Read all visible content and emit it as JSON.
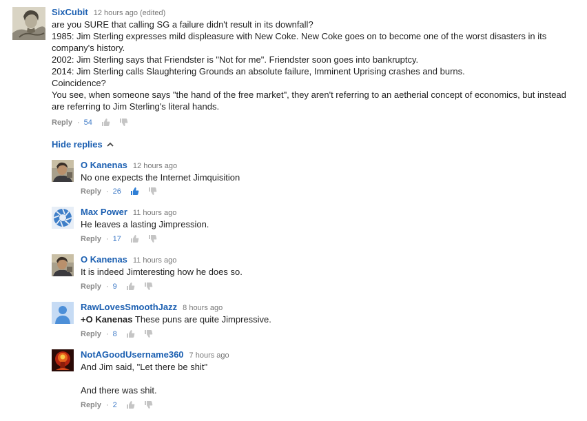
{
  "top_comment": {
    "author": "SixCubit",
    "time": "12 hours ago (edited)",
    "lines": [
      "are you SURE that calling SG a failure didn't result in its downfall?",
      "1985: Jim Sterling expresses mild displeasure with New Coke. New Coke goes on to become one of the worst disasters in its company's history.",
      "2002: Jim Sterling says that Friendster is \"Not for me\". Friendster soon goes into bankruptcy.",
      "2014: Jim Sterling calls Slaughtering Grounds an absolute failure, Imminent Uprising crashes and burns.",
      "Coincidence?",
      "You see, when someone says \"the hand of the free market\", they aren't referring to an aetherial concept of economics, but instead are referring to Jim Sterling's literal hands."
    ],
    "reply_label": "Reply",
    "likes": "54"
  },
  "hide_replies_label": "Hide replies",
  "replies": [
    {
      "author": "O Kanenas",
      "time": "12 hours ago",
      "text": "No one expects the Internet Jimquisition",
      "reply_label": "Reply",
      "likes": "26"
    },
    {
      "author": "Max Power",
      "time": "11 hours ago",
      "text": "He leaves a lasting Jimpression.",
      "reply_label": "Reply",
      "likes": "17"
    },
    {
      "author": "O Kanenas",
      "time": "11 hours ago",
      "text": "It is indeed Jimteresting how he does so.",
      "reply_label": "Reply",
      "likes": "9"
    },
    {
      "author": "RawLovesSmoothJazz",
      "time": "8 hours ago",
      "mention": "+O Kanenas",
      "text": " These puns are quite Jimpressive.",
      "reply_label": "Reply",
      "likes": "8"
    },
    {
      "author": "NotAGoodUsername360",
      "time": "7 hours ago",
      "text": "And Jim said, \"Let there be shit\"",
      "text2": "And there was shit.",
      "reply_label": "Reply",
      "likes": "2"
    }
  ],
  "colors": {
    "author": "#1b5fb1",
    "count": "#3e7ac7",
    "meta": "#777777",
    "text": "#222222"
  },
  "icons": {
    "like": "thumbs-up-icon",
    "dislike": "thumbs-down-icon",
    "hide": "chevron-up-icon"
  }
}
